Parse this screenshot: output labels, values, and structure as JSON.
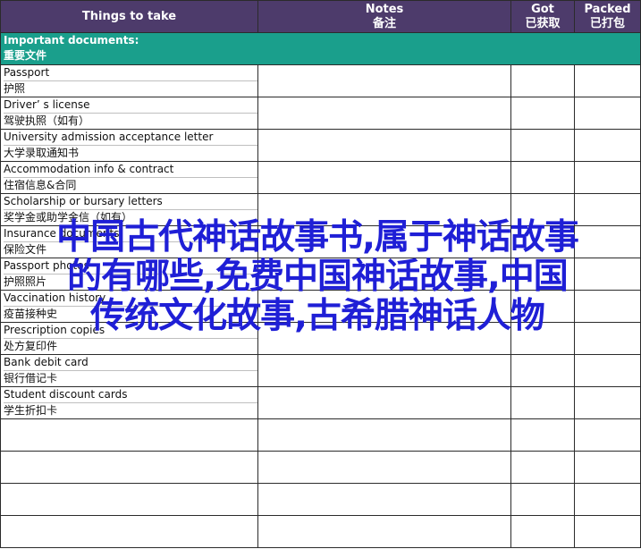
{
  "header": {
    "col1": "Things to take",
    "col2_en": "Notes",
    "col2_zh": "备注",
    "col3_en": "Got",
    "col3_zh": "已获取",
    "col4_en": "Packed",
    "col4_zh": "已打包"
  },
  "section": {
    "en": "Important documents:",
    "zh": "重要文件"
  },
  "items": [
    {
      "en": "Passport",
      "zh": "护照"
    },
    {
      "en": "Driver’ s license",
      "zh": "驾驶执照（如有）"
    },
    {
      "en": "University admission acceptance letter",
      "zh": "大学录取通知书"
    },
    {
      "en": "Accommodation info & contract",
      "zh": "住宿信息&合同"
    },
    {
      "en": "Scholarship or bursary letters",
      "zh": "奖学金或助学金信（如有）"
    },
    {
      "en": "Insurance documents",
      "zh": "保险文件"
    },
    {
      "en": "Passport photos",
      "zh": "护照照片"
    },
    {
      "en": "Vaccination history",
      "zh": "疫苗接种史"
    },
    {
      "en": "Prescription copies",
      "zh": "处方复印件"
    },
    {
      "en": "Bank debit card",
      "zh": "银行借记卡"
    },
    {
      "en": "Student discount cards",
      "zh": "学生折扣卡"
    }
  ],
  "watermark": {
    "line1": "中国古代神话故事书,属于神话故事",
    "line2": "的有哪些,免费中国神话故事,中国",
    "line3": "传统文化故事,古希腊神话人物"
  },
  "colors": {
    "header_bg": "#4d3b6b",
    "section_bg": "#1a9f8c",
    "watermark": "#1f1fd6"
  }
}
